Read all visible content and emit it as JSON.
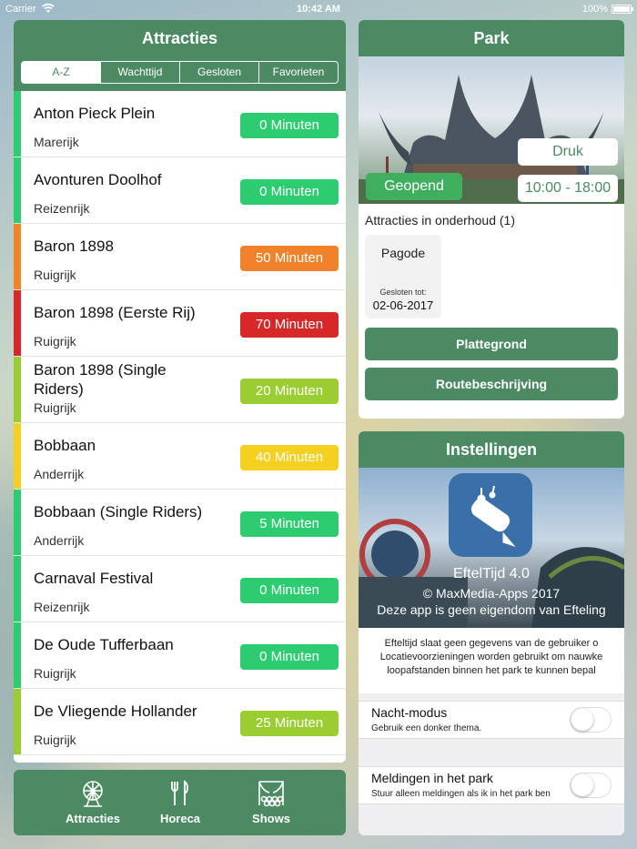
{
  "status_bar": {
    "carrier": "Carrier",
    "time": "10:42 AM",
    "battery": "100%"
  },
  "attracties": {
    "title": "Attracties",
    "tabs": [
      "A-Z",
      "Wachttijd",
      "Gesloten",
      "Favorieten"
    ],
    "active_tab": 0,
    "items": [
      {
        "name": "Anton Pieck Plein",
        "area": "Marerijk",
        "wait": "0 Minuten",
        "color": "#2ecc71"
      },
      {
        "name": "Avonturen Doolhof",
        "area": "Reizenrijk",
        "wait": "0 Minuten",
        "color": "#2ecc71"
      },
      {
        "name": "Baron 1898",
        "area": "Ruigrijk",
        "wait": "50 Minuten",
        "color": "#f0832a"
      },
      {
        "name": "Baron 1898 (Eerste Rij)",
        "area": "Ruigrijk",
        "wait": "70 Minuten",
        "color": "#d62828"
      },
      {
        "name": "Baron 1898 (Single Riders)",
        "area": "Ruigrijk",
        "wait": "20 Minuten",
        "color": "#9acd32"
      },
      {
        "name": "Bobbaan",
        "area": "Anderrijk",
        "wait": "40 Minuten",
        "color": "#f5d020"
      },
      {
        "name": "Bobbaan (Single Riders)",
        "area": "Anderrijk",
        "wait": "5 Minuten",
        "color": "#2ecc71"
      },
      {
        "name": "Carnaval Festival",
        "area": "Reizenrijk",
        "wait": "0 Minuten",
        "color": "#2ecc71"
      },
      {
        "name": "De Oude Tufferbaan",
        "area": "Ruigrijk",
        "wait": "0 Minuten",
        "color": "#2ecc71"
      },
      {
        "name": "De Vliegende Hollander",
        "area": "Ruigrijk",
        "wait": "25 Minuten",
        "color": "#9acd32"
      }
    ]
  },
  "tabbar": {
    "items": [
      {
        "label": "Attracties",
        "icon": "ferris-wheel-icon"
      },
      {
        "label": "Horeca",
        "icon": "fork-knife-icon"
      },
      {
        "label": "Shows",
        "icon": "theater-curtain-icon"
      }
    ]
  },
  "park": {
    "title": "Park",
    "crowd": "Druk",
    "status": "Geopend",
    "hours": "10:00 - 18:00",
    "maintenance_title": "Attracties in onderhoud (1)",
    "maintenance": [
      {
        "name": "Pagode",
        "closed_label": "Gesloten tot:",
        "date": "02-06-2017"
      }
    ],
    "buttons": {
      "map": "Plattegrond",
      "route": "Routebeschrijving"
    }
  },
  "instellingen": {
    "title": "Instellingen",
    "app_name": "EftelTijd 4.0",
    "copyright": "© MaxMedia-Apps 2017",
    "disclaimer": "Deze app is geen eigendom van Efteling",
    "info_lines": [
      "Efteltijd slaat geen gegevens van de gebruiker o",
      "Locatievoorzieningen worden gebruikt om nauwke",
      "loopafstanden binnen het park te kunnen bepal"
    ],
    "settings": [
      {
        "title": "Nacht-modus",
        "subtitle": "Gebruik een donker thema.",
        "enabled": false
      },
      {
        "title": "Meldingen in het park",
        "subtitle": "Stuur alleen meldingen als ik in het park ben",
        "enabled": false
      }
    ]
  },
  "colors": {
    "primary": "#4c8a63",
    "open": "#3fae5e"
  }
}
